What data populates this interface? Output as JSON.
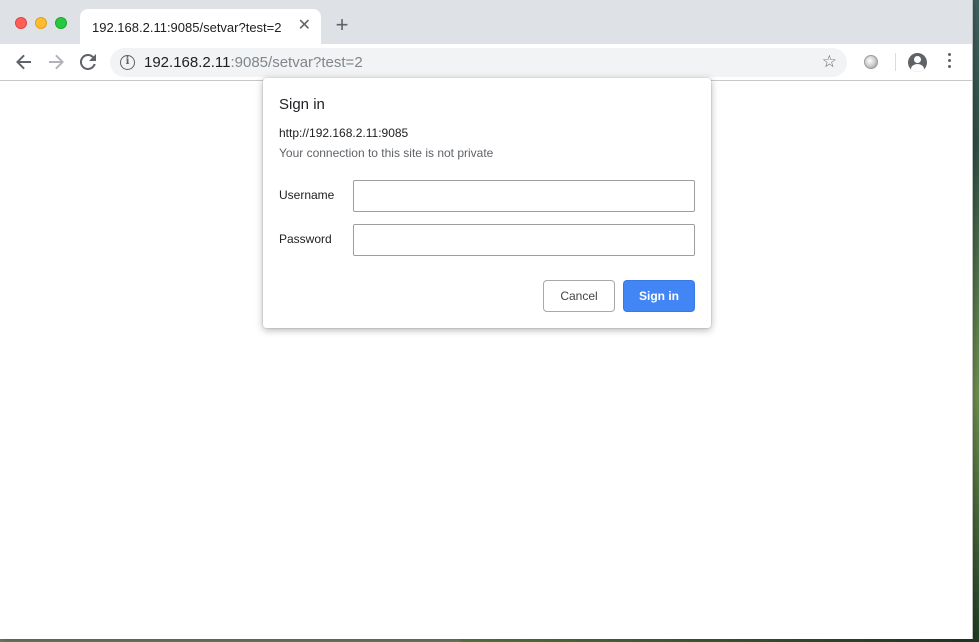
{
  "browser": {
    "tab": {
      "title": "192.168.2.11:9085/setvar?test=2",
      "close_glyph": "✕"
    },
    "new_tab_glyph": "+",
    "address_bar": {
      "host": "192.168.2.11",
      "rest": ":9085/setvar?test=2"
    },
    "icons": {
      "back": "back-arrow-icon",
      "forward": "forward-arrow-icon",
      "reload": "reload-icon",
      "info": "info-icon",
      "star": "star-icon",
      "extension": "extension-icon",
      "profile": "profile-avatar-icon",
      "menu": "kebab-menu-icon"
    }
  },
  "dialog": {
    "title": "Sign in",
    "origin": "http://192.168.2.11:9085",
    "note": "Your connection to this site is not private",
    "username_label": "Username",
    "username_value": "",
    "password_label": "Password",
    "password_value": "",
    "cancel_label": "Cancel",
    "signin_label": "Sign in"
  },
  "colors": {
    "accent": "#4285f4",
    "tabstrip": "#dee1e6",
    "omnibox": "#f1f3f4"
  }
}
